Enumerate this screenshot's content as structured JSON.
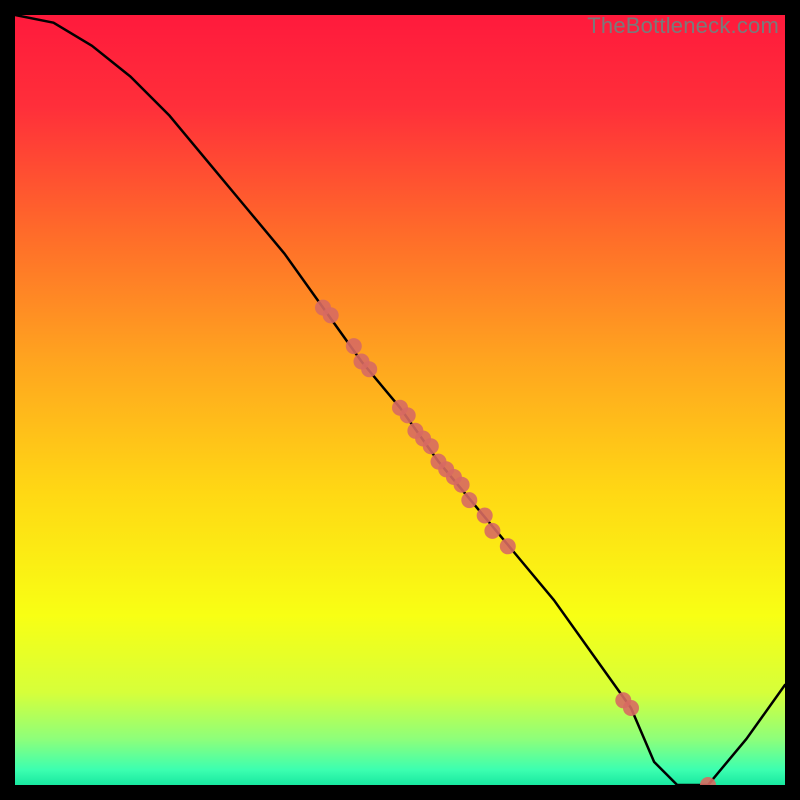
{
  "watermark": "TheBottleneck.com",
  "chart_data": {
    "type": "line",
    "title": "",
    "xlabel": "",
    "ylabel": "",
    "xlim": [
      0,
      100
    ],
    "ylim": [
      0,
      100
    ],
    "gradient_note": "vertical rainbow background red→yellow→green bottom band",
    "curve": {
      "name": "bottleneck-curve",
      "x": [
        0,
        5,
        10,
        15,
        20,
        25,
        30,
        35,
        40,
        45,
        50,
        55,
        60,
        65,
        70,
        75,
        80,
        83,
        86,
        90,
        95,
        100
      ],
      "y": [
        100,
        99,
        96,
        92,
        87,
        81,
        75,
        69,
        62,
        55,
        49,
        42,
        36,
        30,
        24,
        17,
        10,
        3,
        0,
        0,
        6,
        13
      ]
    },
    "scatter": {
      "name": "sample-points",
      "color": "#d76a62",
      "points": [
        {
          "x": 40,
          "y": 62
        },
        {
          "x": 41,
          "y": 61
        },
        {
          "x": 44,
          "y": 57
        },
        {
          "x": 45,
          "y": 55
        },
        {
          "x": 46,
          "y": 54
        },
        {
          "x": 50,
          "y": 49
        },
        {
          "x": 51,
          "y": 48
        },
        {
          "x": 52,
          "y": 46
        },
        {
          "x": 53,
          "y": 45
        },
        {
          "x": 54,
          "y": 44
        },
        {
          "x": 55,
          "y": 42
        },
        {
          "x": 56,
          "y": 41
        },
        {
          "x": 57,
          "y": 40
        },
        {
          "x": 58,
          "y": 39
        },
        {
          "x": 59,
          "y": 37
        },
        {
          "x": 61,
          "y": 35
        },
        {
          "x": 62,
          "y": 33
        },
        {
          "x": 64,
          "y": 31
        },
        {
          "x": 79,
          "y": 11
        },
        {
          "x": 80,
          "y": 10
        },
        {
          "x": 90,
          "y": 0
        }
      ]
    }
  }
}
